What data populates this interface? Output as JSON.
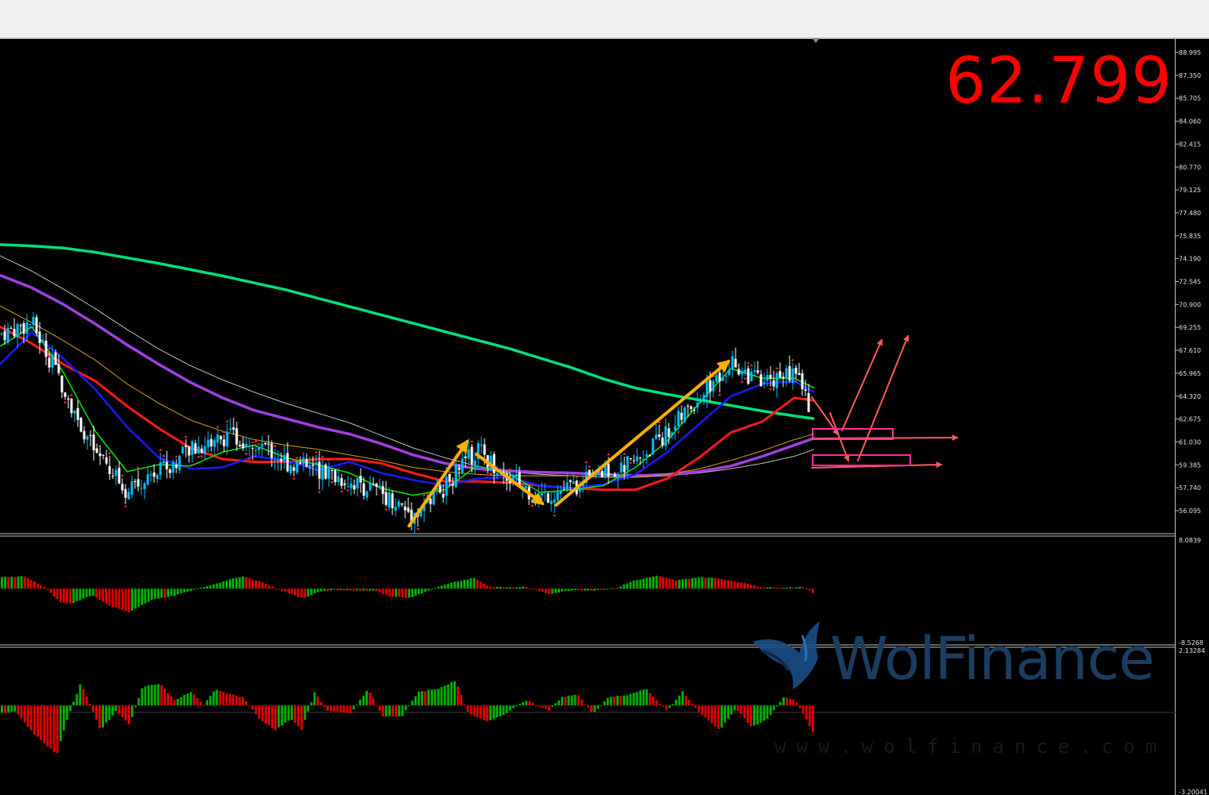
{
  "price_readout": "62.799",
  "watermark": {
    "brand": "WolFinance",
    "url": "www.wolfinance.com",
    "logo_icon": "wolf-head-icon"
  },
  "colors": {
    "background": "#000000",
    "bull_candle": "#00bfff",
    "bear_candle": "#ffffff",
    "ma_fast_green": "#00e000",
    "ma_blue": "#1a1aff",
    "ma_red": "#ff1a1a",
    "ma_purple": "#a040e0",
    "ma_long_green": "#00e07a",
    "ma_gold": "#d4a017",
    "ma_grey": "#c0c0c0",
    "arrow_gold": "#ffb000",
    "arrow_red": "#ff5a5a",
    "zone_pink": "#ff2fa0",
    "hist_up": "#00b000",
    "hist_down": "#e00000"
  },
  "chart_data": [
    {
      "type": "line",
      "panel": "price",
      "y_axis_ticks": [
        "88.995",
        "87.350",
        "85.705",
        "84.060",
        "82.415",
        "80.770",
        "79.125",
        "77.480",
        "75.835",
        "74.190",
        "72.545",
        "70.900",
        "69.255",
        "67.610",
        "65.965",
        "64.320",
        "62.675",
        "61.030",
        "59.385",
        "57.740",
        "56.095"
      ],
      "ylim": [
        54.8,
        89.8
      ],
      "x": [
        0,
        40,
        80,
        120,
        160,
        200,
        240,
        280,
        320,
        360,
        400,
        440,
        480,
        520,
        560,
        600,
        640,
        680,
        720,
        760,
        800,
        840,
        880,
        920,
        960,
        1000,
        1025
      ],
      "series": [
        {
          "key": "ma_long_green",
          "values": [
            75.2,
            75.1,
            74.95,
            74.65,
            74.25,
            73.85,
            73.4,
            72.95,
            72.45,
            71.95,
            71.35,
            70.75,
            70.15,
            69.55,
            68.95,
            68.35,
            67.75,
            67.05,
            66.35,
            65.55,
            64.9,
            64.45,
            64.05,
            63.65,
            63.25,
            62.9,
            62.7
          ]
        },
        {
          "key": "ma_grey",
          "values": [
            74.4,
            73.3,
            72.0,
            70.6,
            69.1,
            67.7,
            66.5,
            65.5,
            64.6,
            63.8,
            63.1,
            62.4,
            61.5,
            60.6,
            59.9,
            59.3,
            58.9,
            58.7,
            58.6,
            58.5,
            58.5,
            58.6,
            58.8,
            59.1,
            59.5,
            60.0,
            60.5
          ]
        },
        {
          "key": "ma_purple",
          "values": [
            73.0,
            72.1,
            70.9,
            69.5,
            68.0,
            66.6,
            65.3,
            64.2,
            63.3,
            62.7,
            62.1,
            61.6,
            60.9,
            60.1,
            59.5,
            59.1,
            58.95,
            58.85,
            58.8,
            58.7,
            58.6,
            58.7,
            58.9,
            59.3,
            60.0,
            60.8,
            61.3
          ]
        },
        {
          "key": "ma_gold",
          "values": [
            70.8,
            69.6,
            68.3,
            66.9,
            65.2,
            63.8,
            62.6,
            61.8,
            61.2,
            60.8,
            60.5,
            60.1,
            59.7,
            59.2,
            58.9,
            58.7,
            58.6,
            58.6,
            58.6,
            58.5,
            58.5,
            58.7,
            59.1,
            59.7,
            60.4,
            61.2,
            61.6
          ]
        },
        {
          "key": "ma_red",
          "values": [
            69.3,
            68.1,
            66.6,
            65.4,
            63.6,
            62.0,
            60.6,
            59.8,
            59.6,
            59.6,
            59.8,
            59.8,
            59.5,
            58.8,
            58.2,
            58.2,
            58.1,
            57.9,
            57.7,
            57.6,
            57.6,
            58.4,
            59.9,
            61.7,
            62.5,
            64.2,
            64.0
          ]
        },
        {
          "key": "ma_blue",
          "values": [
            66.6,
            68.9,
            67.0,
            64.8,
            62.1,
            59.9,
            59.1,
            59.2,
            60.0,
            59.7,
            59.0,
            59.6,
            58.8,
            58.3,
            57.9,
            58.4,
            58.5,
            57.9,
            57.7,
            58.0,
            58.7,
            60.3,
            62.3,
            64.3,
            65.2,
            65.4,
            64.6
          ]
        },
        {
          "key": "ma_fast_green",
          "values": [
            67.9,
            69.3,
            66.0,
            61.8,
            58.9,
            59.4,
            59.3,
            60.3,
            60.8,
            59.9,
            59.4,
            58.8,
            57.7,
            57.2,
            57.6,
            59.3,
            58.8,
            57.4,
            57.6,
            57.9,
            59.2,
            61.1,
            63.8,
            66.3,
            65.6,
            65.6,
            64.9
          ]
        },
        {
          "key": "close",
          "values": [
            68.8,
            69.6,
            65.0,
            60.2,
            57.5,
            58.9,
            60.4,
            61.4,
            61.2,
            59.6,
            59.0,
            58.2,
            57.4,
            55.8,
            57.8,
            60.5,
            58.5,
            57.1,
            57.8,
            58.7,
            59.6,
            61.7,
            64.2,
            66.8,
            65.1,
            66.2,
            62.8
          ]
        }
      ],
      "series_names": []
    },
    {
      "type": "bar",
      "panel": "oscillator_1",
      "y_axis_ticks": [
        "8.0839",
        "-8.5268"
      ],
      "ylim": [
        -8.5268,
        8.0839
      ],
      "bar_count": 250,
      "x_end": 1025,
      "knots": [
        [
          0,
          1.8
        ],
        [
          30,
          1.9
        ],
        [
          55,
          0.2
        ],
        [
          75,
          -2.2
        ],
        [
          90,
          -2.3
        ],
        [
          115,
          -1.0
        ],
        [
          135,
          -2.6
        ],
        [
          160,
          -3.7
        ],
        [
          190,
          -1.7
        ],
        [
          215,
          -1.2
        ],
        [
          240,
          -0.3
        ],
        [
          265,
          0.6
        ],
        [
          290,
          1.5
        ],
        [
          305,
          1.9
        ],
        [
          325,
          1.2
        ],
        [
          345,
          0.1
        ],
        [
          380,
          -1.5
        ],
        [
          400,
          -0.5
        ],
        [
          420,
          -0.2
        ],
        [
          440,
          -0.3
        ],
        [
          470,
          -0.3
        ],
        [
          490,
          -1.3
        ],
        [
          515,
          -1.4
        ],
        [
          540,
          -0.2
        ],
        [
          565,
          0.9
        ],
        [
          595,
          1.7
        ],
        [
          615,
          0.3
        ],
        [
          640,
          0.2
        ],
        [
          660,
          0.3
        ],
        [
          690,
          -0.8
        ],
        [
          720,
          -0.2
        ],
        [
          745,
          -0.3
        ],
        [
          775,
          0.1
        ],
        [
          795,
          1.2
        ],
        [
          825,
          2.0
        ],
        [
          850,
          1.3
        ],
        [
          880,
          1.8
        ],
        [
          905,
          1.6
        ],
        [
          930,
          1.0
        ],
        [
          960,
          0.2
        ],
        [
          990,
          0.2
        ],
        [
          1010,
          0.3
        ],
        [
          1025,
          -0.9
        ]
      ]
    },
    {
      "type": "bar",
      "panel": "oscillator_2",
      "y_axis_ticks": [
        "2.13284",
        "-3.20041"
      ],
      "ylim": [
        -3.20041,
        2.13284
      ],
      "bar_count": 250,
      "x_end": 1025,
      "knots": [
        [
          0,
          -0.3
        ],
        [
          18,
          -0.2
        ],
        [
          40,
          -1.0
        ],
        [
          70,
          -1.8
        ],
        [
          82,
          -0.6
        ],
        [
          100,
          0.8
        ],
        [
          110,
          0.2
        ],
        [
          125,
          -0.9
        ],
        [
          145,
          -0.2
        ],
        [
          162,
          -0.7
        ],
        [
          178,
          0.7
        ],
        [
          200,
          0.8
        ],
        [
          218,
          0.2
        ],
        [
          240,
          0.5
        ],
        [
          255,
          0.0
        ],
        [
          270,
          0.6
        ],
        [
          290,
          0.4
        ],
        [
          305,
          0.3
        ],
        [
          325,
          -0.5
        ],
        [
          345,
          -0.9
        ],
        [
          365,
          -0.5
        ],
        [
          378,
          -0.9
        ],
        [
          395,
          0.5
        ],
        [
          410,
          -0.2
        ],
        [
          440,
          -0.3
        ],
        [
          462,
          0.6
        ],
        [
          480,
          -0.4
        ],
        [
          505,
          -0.4
        ],
        [
          525,
          0.5
        ],
        [
          548,
          0.6
        ],
        [
          572,
          0.9
        ],
        [
          588,
          -0.3
        ],
        [
          612,
          -0.6
        ],
        [
          635,
          -0.3
        ],
        [
          660,
          0.2
        ],
        [
          690,
          -0.2
        ],
        [
          705,
          0.3
        ],
        [
          725,
          0.4
        ],
        [
          745,
          -0.3
        ],
        [
          765,
          0.3
        ],
        [
          790,
          0.4
        ],
        [
          812,
          0.6
        ],
        [
          838,
          -0.2
        ],
        [
          858,
          0.5
        ],
        [
          880,
          -0.3
        ],
        [
          905,
          -0.9
        ],
        [
          925,
          -0.1
        ],
        [
          945,
          -0.8
        ],
        [
          965,
          -0.5
        ],
        [
          985,
          0.3
        ],
        [
          1000,
          0.2
        ],
        [
          1015,
          -0.6
        ],
        [
          1025,
          -1.2
        ]
      ]
    }
  ]
}
